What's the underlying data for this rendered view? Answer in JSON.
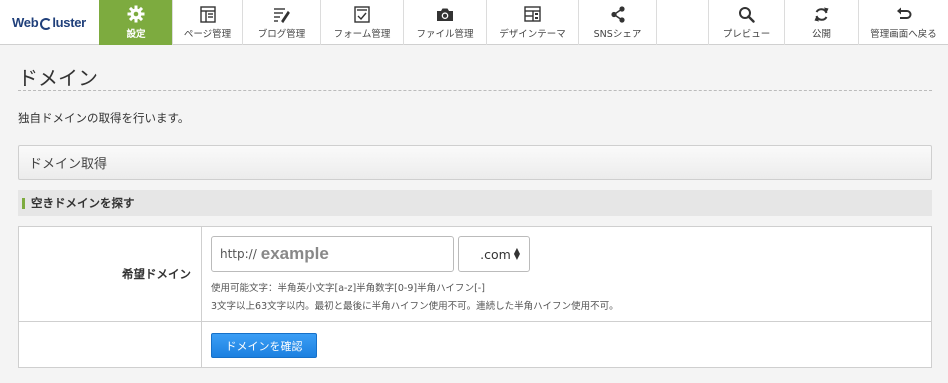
{
  "brand": {
    "logo_text_a": "Web",
    "logo_text_b": "luster"
  },
  "nav": {
    "settings": "設定",
    "pages": "ページ管理",
    "blog": "ブログ管理",
    "forms": "フォーム管理",
    "files": "ファイル管理",
    "design": "デザインテーマ",
    "sns": "SNSシェア",
    "preview": "プレビュー",
    "publish": "公開",
    "back": "管理画面へ戻る"
  },
  "page": {
    "title": "ドメイン",
    "description": "独自ドメインの取得を行います。",
    "section_title": "ドメイン取得",
    "subsection_title": "空きドメインを探す"
  },
  "form": {
    "label": "希望ドメイン",
    "prefix": "http://",
    "placeholder": "example",
    "tld_value": ".com",
    "hint1": "使用可能文字：半角英小文字[a-z]半角数字[0-9]半角ハイフン[-]",
    "hint2": "3文字以上63文字以内。最初と最後に半角ハイフン使用不可。連続した半角ハイフン使用不可。",
    "submit_label": "ドメインを確認"
  },
  "colors": {
    "accent": "#7dab3f",
    "button": "#1c80e0"
  },
  "icons": [
    "gear-icon",
    "page-icon",
    "blog-icon",
    "form-icon",
    "camera-icon",
    "layout-icon",
    "share-icon",
    "search-icon",
    "refresh-icon",
    "return-icon"
  ]
}
